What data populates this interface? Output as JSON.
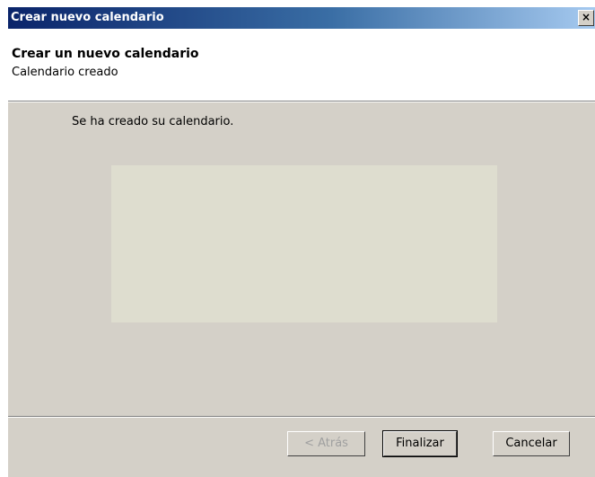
{
  "window": {
    "title": "Crear nuevo calendario",
    "close_glyph": "×"
  },
  "header": {
    "title": "Crear un nuevo calendario",
    "subtitle": "Calendario creado"
  },
  "main": {
    "message": "Se ha creado su calendario."
  },
  "buttons": {
    "back_label": "< Atrás",
    "finish_label": "Finalizar",
    "cancel_label": "Cancelar"
  },
  "colors": {
    "title_bar_start": "#0a246a",
    "title_bar_end": "#a6caf0",
    "dialog_background": "#d4d0c8",
    "preview_area": "#deddcf"
  },
  "icons": {
    "close": "close-icon"
  }
}
